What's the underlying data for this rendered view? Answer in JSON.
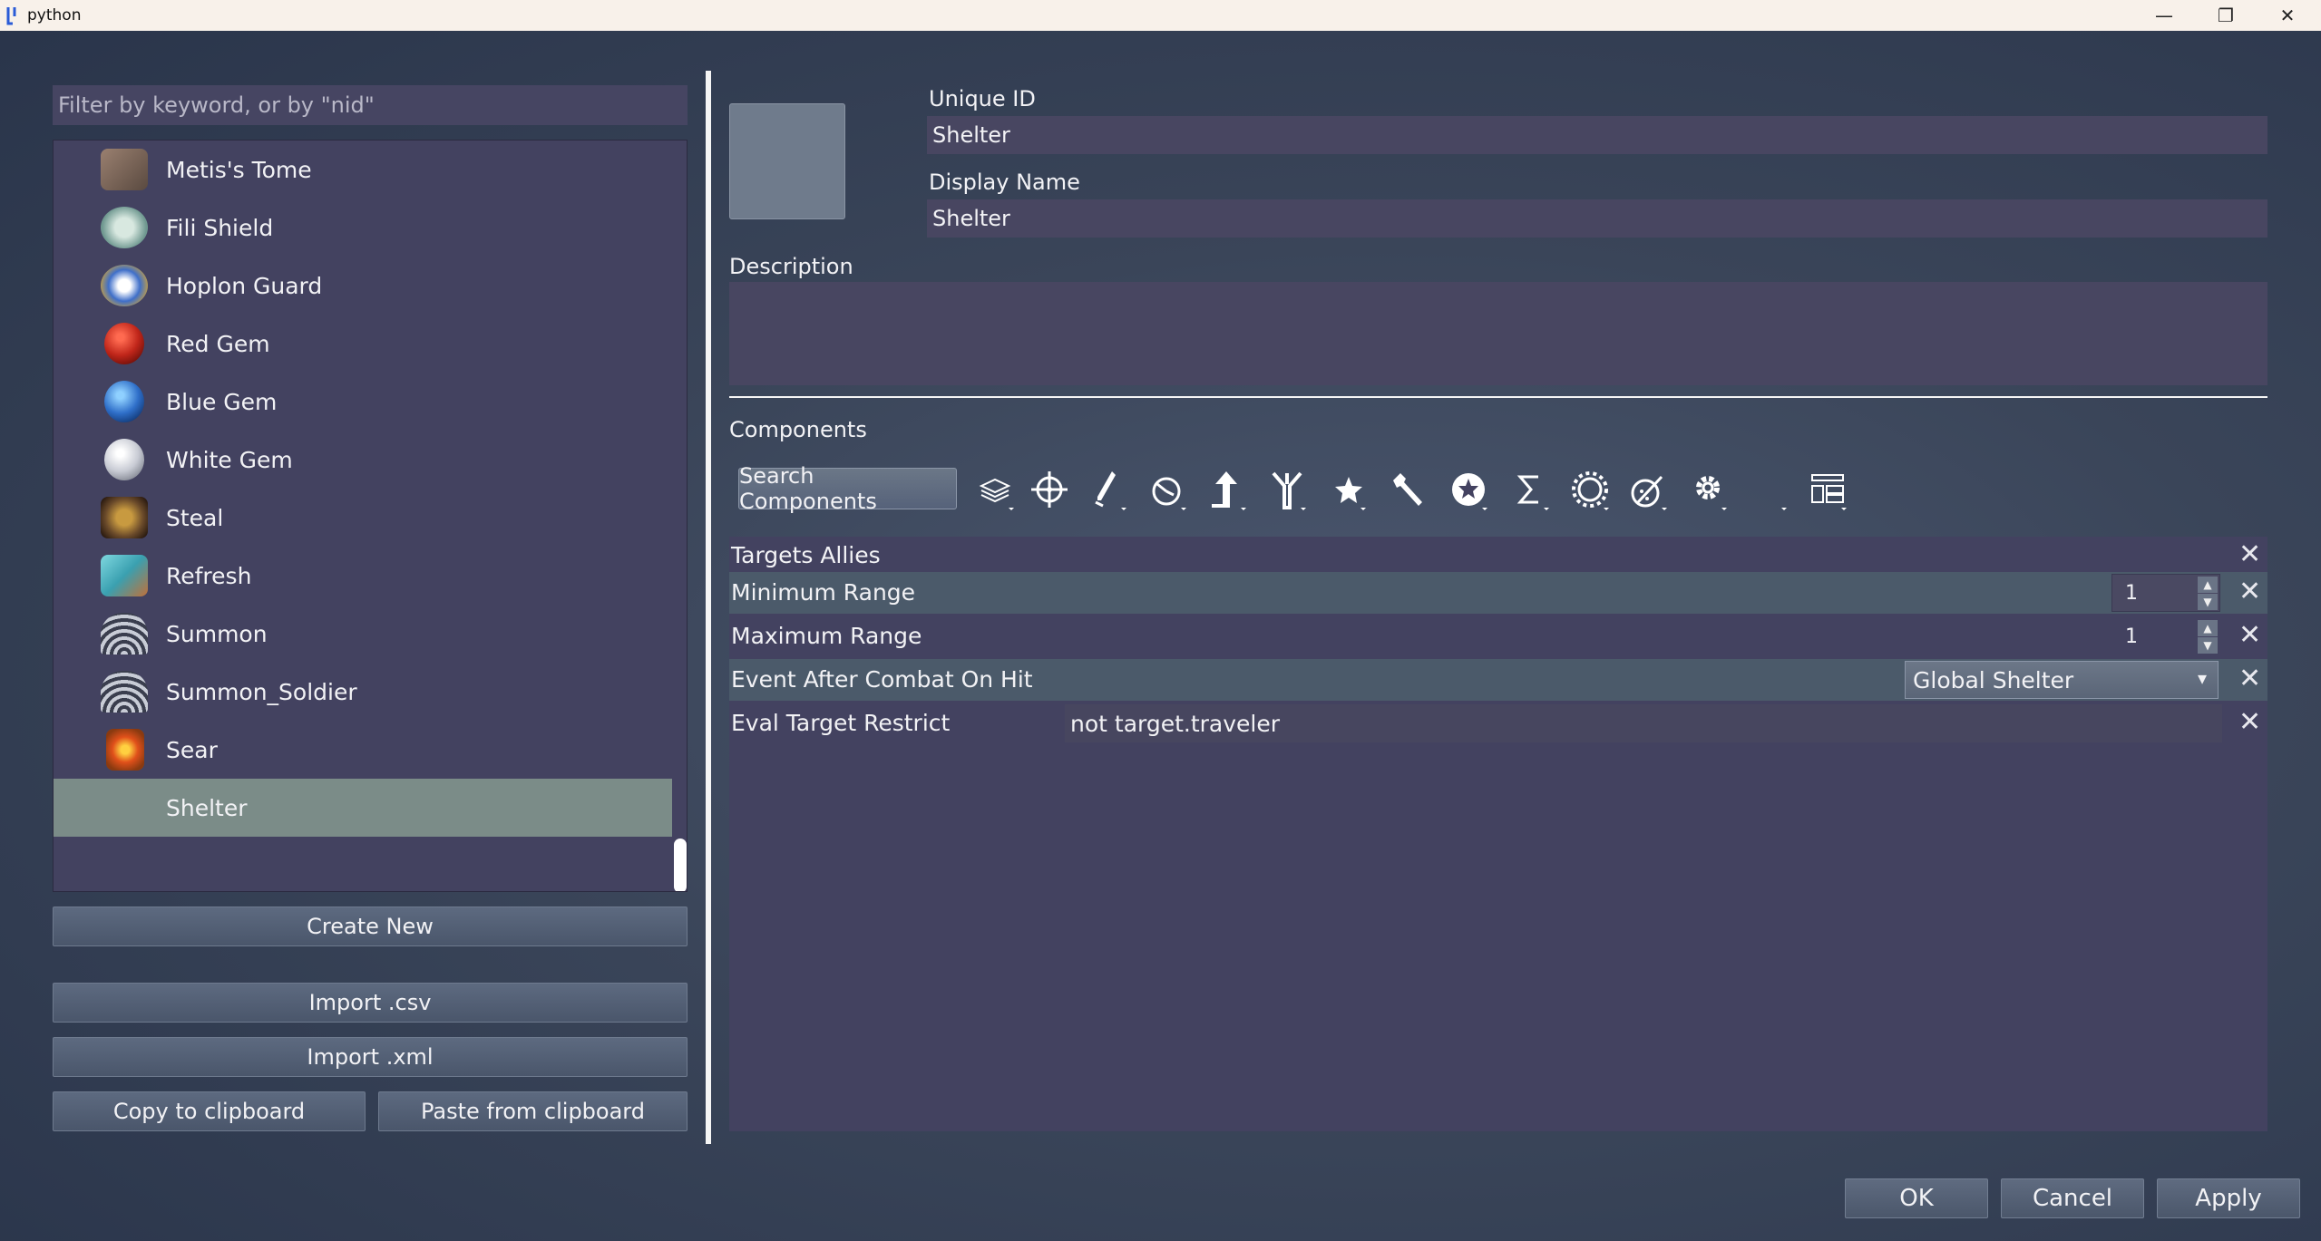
{
  "window": {
    "title": "python",
    "minimize": "—",
    "maximize": "❐",
    "close": "✕"
  },
  "filter": {
    "placeholder": "Filter by keyword, or by \"nid\""
  },
  "items": [
    {
      "label": "Metis's Tome",
      "icon": "tome-icon",
      "color": "#8a7060"
    },
    {
      "label": "Fili Shield",
      "icon": "shield-icon",
      "color": "#8fb8b0"
    },
    {
      "label": "Hoplon Guard",
      "icon": "guard-icon",
      "color": "#4f7fd0"
    },
    {
      "label": "Red Gem",
      "icon": "red-gem-icon",
      "color": "#c0261a"
    },
    {
      "label": "Blue Gem",
      "icon": "blue-gem-icon",
      "color": "#2f6fc9"
    },
    {
      "label": "White Gem",
      "icon": "white-gem-icon",
      "color": "#c8cbd4"
    },
    {
      "label": "Steal",
      "icon": "steal-icon",
      "color": "#6a4a2a"
    },
    {
      "label": "Refresh",
      "icon": "refresh-icon",
      "color": "#3aa0b0"
    },
    {
      "label": "Summon",
      "icon": "summon-icon",
      "color": "#565a6a"
    },
    {
      "label": "Summon_Soldier",
      "icon": "summon-soldier-icon",
      "color": "#565a6a"
    },
    {
      "label": "Sear",
      "icon": "sear-icon",
      "color": "#c0501a"
    },
    {
      "label": "Shelter",
      "icon": "",
      "color": ""
    }
  ],
  "buttons": {
    "create_new": "Create New",
    "import_csv": "Import .csv",
    "import_xml": "Import .xml",
    "copy_clipboard": "Copy to clipboard",
    "paste_clipboard": "Paste from clipboard",
    "ok": "OK",
    "cancel": "Cancel",
    "apply": "Apply"
  },
  "details": {
    "unique_id_label": "Unique ID",
    "unique_id": "Shelter",
    "display_name_label": "Display Name",
    "display_name": "Shelter",
    "description_label": "Description",
    "description": "",
    "components_label": "Components",
    "search_components": "Search Components"
  },
  "toolbar_icons": [
    "layers-icon",
    "crosshair-icon",
    "sword-icon",
    "clock-icon",
    "arrow-up-icon",
    "fork-icon",
    "star-icon",
    "wrench-icon",
    "badge-star-icon",
    "sigma-icon",
    "burst-icon",
    "palette-icon",
    "gear-icon",
    "blank-icon",
    "layout-icon"
  ],
  "components": {
    "targets_allies": "Targets Allies",
    "min_range_label": "Minimum Range",
    "min_range": "1",
    "max_range_label": "Maximum Range",
    "max_range": "1",
    "event_label": "Event After Combat On Hit",
    "event_value": "Global Shelter",
    "eval_label": "Eval Target Restrict",
    "eval_value": "not target.traveler",
    "remove": "✕"
  }
}
